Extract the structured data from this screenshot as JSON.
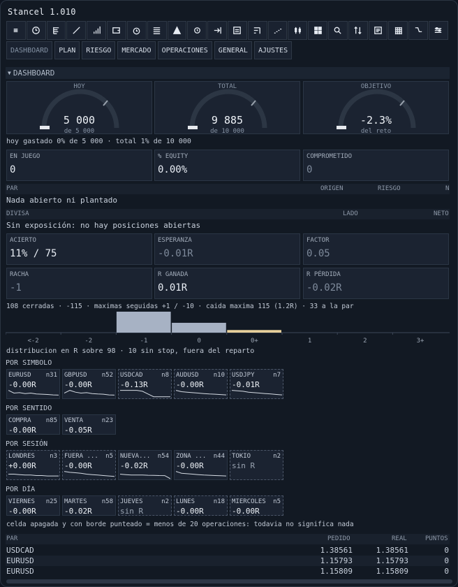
{
  "app": {
    "title": "Stancel 1.010"
  },
  "toolbar": {
    "icons": [
      "menu-icon",
      "clock-icon",
      "tree-icon",
      "line-icon",
      "bar-chart-icon",
      "wallet-icon",
      "timer-icon",
      "list-icon",
      "mountain-icon",
      "history-icon",
      "arrow-right-bar-icon",
      "panel-icon",
      "steps-icon",
      "dashes-icon",
      "candles-icon",
      "grid-large-icon",
      "magnifier-icon",
      "sort-icon",
      "document-icon",
      "grid-small-icon",
      "drop-curve-icon",
      "sliders-icon"
    ]
  },
  "tabs": [
    "DASHBOARD",
    "PLAN",
    "RIESGO",
    "MERCADO",
    "OPERACIONES",
    "GENERAL",
    "AJUSTES"
  ],
  "section": {
    "title": "DASHBOARD"
  },
  "gauges": [
    {
      "label": "HOY",
      "value": "5 000",
      "sub": "de 5 000",
      "level": 0
    },
    {
      "label": "TOTAL",
      "value": "9 885",
      "sub": "de 10 000",
      "level": 0.01
    },
    {
      "label": "OBJETIVO",
      "value": "-2.3%",
      "sub": "del reto",
      "level": 0
    }
  ],
  "gauge_note": "hoy gastado 0% de 5 000  ·  total 1% de 10 000",
  "cards_top": [
    {
      "label": "EN JUEGO",
      "value": "0"
    },
    {
      "label": "% EQUITY",
      "value": "0.00%"
    },
    {
      "label": "COMPROMETIDO",
      "value": "0"
    }
  ],
  "positions": {
    "headers": [
      "PAR",
      "ORIGEN",
      "RIESGO",
      "N"
    ],
    "empty": "Nada abierto ni plantado"
  },
  "exposure": {
    "headers": [
      "DIVISA",
      "LADO",
      "NETO"
    ],
    "empty": "Sin exposición: no hay posiciones abiertas"
  },
  "stats": [
    {
      "label": "ACIERTO",
      "value": "11% / 75"
    },
    {
      "label": "ESPERANZA",
      "value": "-0.01R"
    },
    {
      "label": "FACTOR",
      "value": "0.05"
    },
    {
      "label": "RACHA",
      "value": "-1"
    },
    {
      "label": "R GANADA",
      "value": "0.01R"
    },
    {
      "label": "R PÉRDIDA",
      "value": "-0.02R"
    }
  ],
  "summary": "108 cerradas · -115 · maximas seguidas +1 / -10 · caida maxima 115 (1.2R) · 33 a la par",
  "chart_data": {
    "type": "bar",
    "categories": [
      "<-2",
      "-2",
      "-1",
      "0",
      "0+",
      "1",
      "2",
      "3+"
    ],
    "values": [
      0,
      0,
      32,
      15,
      4,
      0,
      0,
      0
    ],
    "colors": [
      "#a7b2c4",
      "#a7b2c4",
      "#a7b2c4",
      "#a7b2c4",
      "#e6cf9a",
      "#a7b2c4",
      "#a7b2c4",
      "#a7b2c4"
    ]
  },
  "distribution_note": "distribucion en R sobre 98 · 10 sin stop, fuera del reparto",
  "groups": [
    {
      "title": "POR SIMBOLO",
      "items": [
        {
          "name": "EURUSD",
          "n": "n31",
          "value": "-0.00R",
          "trend": [
            0.2,
            0.5,
            0.45,
            0.55,
            0.5,
            0.6,
            0.62,
            0.65,
            0.7,
            0.72
          ]
        },
        {
          "name": "GBPUSD",
          "n": "n52",
          "value": "-0.00R",
          "trend": [
            0.5,
            0.2,
            0.4,
            0.5,
            0.45,
            0.55,
            0.6,
            0.62,
            0.7,
            0.72
          ]
        },
        {
          "name": "USDCAD",
          "n": "n8",
          "value": "-0.13R",
          "trend": [
            0.2,
            0.2,
            0.2,
            0.2,
            0.3,
            0.6,
            0.9,
            0.9,
            0.9,
            0.9
          ]
        },
        {
          "name": "AUDUSD",
          "n": "n10",
          "value": "-0.00R",
          "trend": [
            0.2,
            0.35,
            0.4,
            0.45,
            0.5,
            0.55,
            0.6,
            0.62,
            0.66,
            0.7
          ]
        },
        {
          "name": "USDJPY",
          "n": "n7",
          "value": "-0.01R",
          "trend": [
            0.2,
            0.25,
            0.3,
            0.4,
            0.45,
            0.5,
            0.55,
            0.6,
            0.65,
            0.7
          ]
        }
      ]
    },
    {
      "title": "POR SENTIDO",
      "items": [
        {
          "name": "COMPRA",
          "n": "n85",
          "value": "-0.00R",
          "trend": []
        },
        {
          "name": "VENTA",
          "n": "n23",
          "value": "-0.05R",
          "trend": []
        }
      ]
    },
    {
      "title": "POR SESIÓN",
      "items": [
        {
          "name": "LONDRES",
          "n": "n3",
          "value": "+0.00R",
          "trend": [
            0.5,
            0.5,
            0.55,
            0.6,
            0.6,
            0.65,
            0.65,
            0.7,
            0.7,
            0.7
          ]
        },
        {
          "name": "FUERA ...",
          "n": "n5",
          "value": "-0.00R",
          "trend": [
            0.2,
            0.3,
            0.35,
            0.4,
            0.5,
            0.55,
            0.6,
            0.65,
            0.7,
            0.75
          ]
        },
        {
          "name": "NUEVA...",
          "n": "n54",
          "value": "-0.02R",
          "trend": [
            0.5,
            0.55,
            0.6,
            0.6,
            0.6,
            0.62,
            0.63,
            0.65,
            0.66,
            1.0
          ]
        },
        {
          "name": "ZONA ...",
          "n": "n44",
          "value": "-0.00R",
          "trend": [
            0.2,
            0.4,
            0.45,
            0.5,
            0.55,
            0.6,
            0.62,
            0.65,
            0.68,
            0.7
          ]
        },
        {
          "name": "TOKIO",
          "n": "n2",
          "value": "sin R",
          "trend": []
        }
      ]
    },
    {
      "title": "POR DÍA",
      "items": [
        {
          "name": "VIERNES",
          "n": "n25",
          "value": "-0.00R",
          "trend": []
        },
        {
          "name": "MARTES",
          "n": "n58",
          "value": "-0.02R",
          "trend": []
        },
        {
          "name": "JUEVES",
          "n": "n2",
          "value": "sin R",
          "trend": []
        },
        {
          "name": "LUNES",
          "n": "n18",
          "value": "-0.00R",
          "trend": []
        },
        {
          "name": "MIERCOLES",
          "n": "n5",
          "value": "-0.00R",
          "trend": []
        }
      ]
    }
  ],
  "footnote": "celda apagada y con borde punteado = menos de 20 operaciones: todavia no significa nada",
  "prices": {
    "headers": [
      "PAR",
      "PEDIDO",
      "REAL",
      "PUNTOS"
    ],
    "rows": [
      [
        "USDCAD",
        "1.38561",
        "1.38561",
        "0"
      ],
      [
        "EURUSD",
        "1.15793",
        "1.15793",
        "0"
      ],
      [
        "EURUSD",
        "1.15809",
        "1.15809",
        "0"
      ]
    ]
  }
}
